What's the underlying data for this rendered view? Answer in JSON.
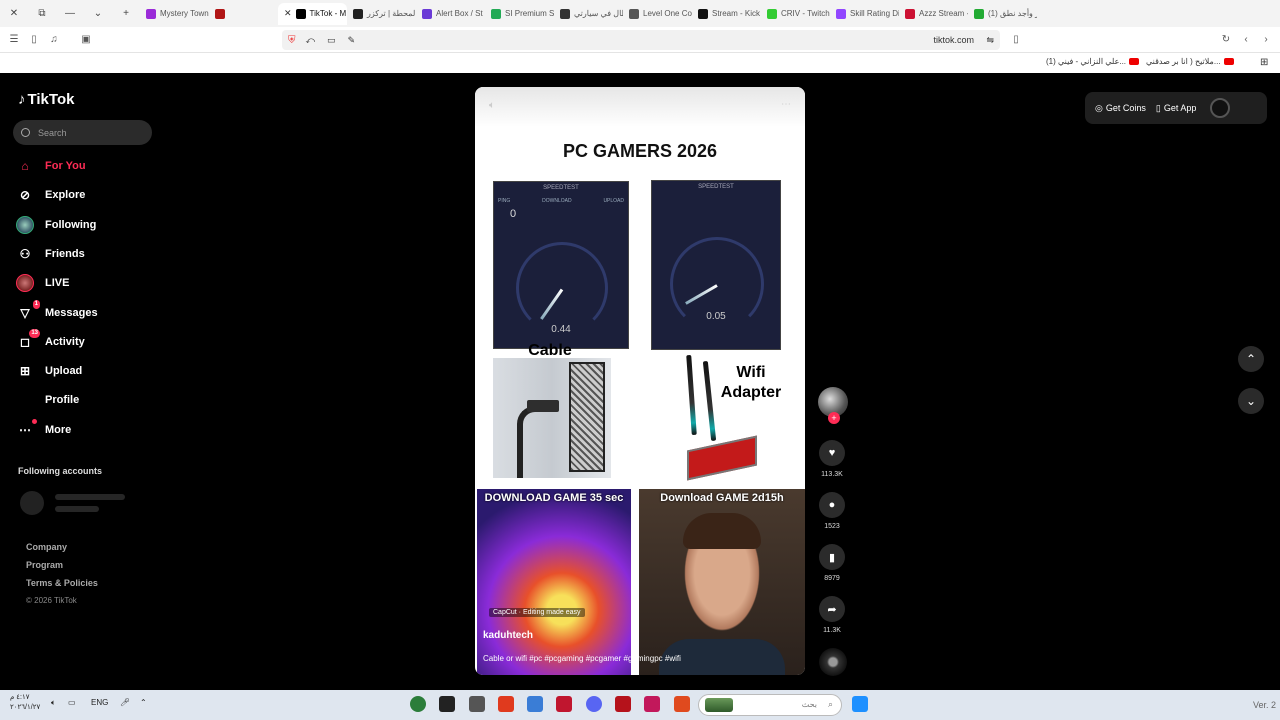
{
  "browser": {
    "tabs": [
      {
        "label": "Mystery Town",
        "color": "#9a2bd8"
      },
      {
        "label": "",
        "color": "#b01515"
      },
      {
        "label": "TikTok - M",
        "color": "#000000",
        "active": true
      },
      {
        "label": "المحطة | تركزر",
        "color": "#222222"
      },
      {
        "label": "Alert Box / St",
        "color": "#6a3ad6"
      },
      {
        "label": "SI Premium S",
        "color": "#22aa55"
      },
      {
        "label": "أبطال في سيارتي",
        "color": "#333333"
      },
      {
        "label": "Level One Co",
        "color": "#555555"
      },
      {
        "label": "Stream - Kick D",
        "color": "#111111"
      },
      {
        "label": "CRIV - Twitch",
        "color": "#33cc33"
      },
      {
        "label": "Skill Rating Distr",
        "color": "#9146ff"
      },
      {
        "label": "Azzz Stream - W",
        "color": "#cc1133"
      },
      {
        "label": "(1) أثر وأجد نطق",
        "color": "#22aa33"
      }
    ],
    "url_domain": "tiktok.com",
    "bookmarks": [
      "(1) علي النزاني - فيني...",
      "ملاتيح ( انا بر صدقني..."
    ]
  },
  "sidebar": {
    "logo": "TikTok",
    "search_placeholder": "Search",
    "nav": [
      {
        "label": "For You",
        "icon": "home-icon",
        "active": true
      },
      {
        "label": "Explore",
        "icon": "compass-icon"
      },
      {
        "label": "Following",
        "icon": "following-avatar-icon"
      },
      {
        "label": "Friends",
        "icon": "friends-icon"
      },
      {
        "label": "LIVE",
        "icon": "live-icon"
      },
      {
        "label": "Messages",
        "icon": "messages-icon",
        "badge": "1"
      },
      {
        "label": "Activity",
        "icon": "activity-icon",
        "badge": "13"
      },
      {
        "label": "Upload",
        "icon": "upload-icon"
      },
      {
        "label": "Profile",
        "icon": "profile-icon"
      },
      {
        "label": "More",
        "icon": "more-icon",
        "dot": true
      }
    ],
    "following_title": "Following accounts",
    "footer": [
      "Company",
      "Program",
      "Terms & Policies"
    ],
    "copyright": "© 2026 TikTok"
  },
  "topbar": {
    "get_coins": "Get Coins",
    "get_app": "Get App"
  },
  "video": {
    "title": "PC GAMERS 2026",
    "speedtest_left": {
      "header": "SPEEDTEST",
      "ping_label": "PING",
      "download_label": "DOWNLOAD",
      "upload_label": "UPLOAD",
      "ping": "0",
      "value": "0.44"
    },
    "speedtest_right": {
      "header": "SPEEDTEST",
      "value": "0.05"
    },
    "label_cable": "Cable",
    "label_wifi": "Wifi Adapter",
    "thumb_left_caption": "DOWNLOAD GAME 35 sec",
    "thumb_right_caption": "Download GAME 2d15h",
    "capcut": "CapCut · Editing made easy",
    "author": "kaduhtech",
    "description": "Cable or wifi #pc #pcgaming #pcgamer #gamingpc #wifi"
  },
  "actions": {
    "likes": "113.3K",
    "comments": "1523",
    "saves": "8979",
    "shares": "11.3K"
  },
  "taskbar": {
    "time": "٤:١٧ م",
    "date": "٢٠٢٦/١/٢٧",
    "lang": "ENG",
    "search_placeholder": "بحث",
    "version": "Ver. 2"
  },
  "colors": {
    "accent": "#fe2c55",
    "page_bg": "#000000",
    "sidebar_text": "#ffffff"
  }
}
